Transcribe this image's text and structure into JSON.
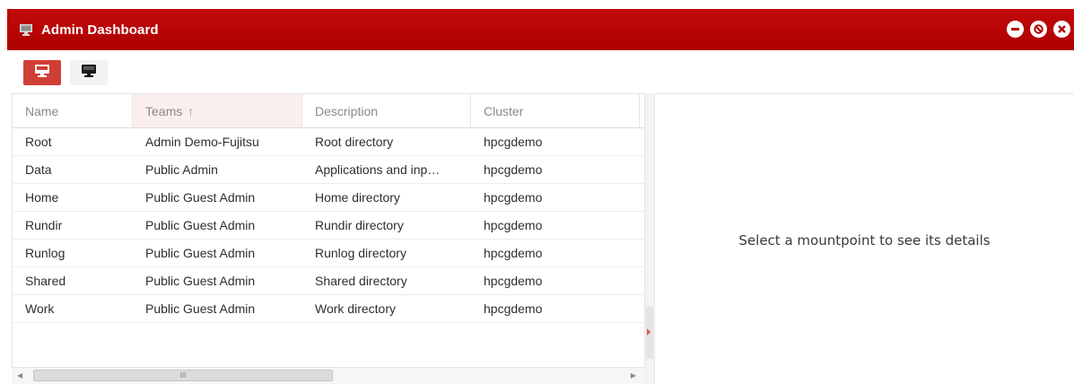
{
  "window": {
    "title": "Admin Dashboard",
    "accent_color": "#b30000",
    "controls": [
      "minimize-icon",
      "restore-icon",
      "close-icon"
    ]
  },
  "toolbar": {
    "buttons": [
      {
        "icon": "monitor-icon",
        "state": "active"
      },
      {
        "icon": "monitor-dark-icon",
        "state": "inactive"
      }
    ]
  },
  "grid": {
    "columns": [
      {
        "label": "Name"
      },
      {
        "label": "Teams",
        "sort": "↑"
      },
      {
        "label": "Description"
      },
      {
        "label": "Cluster"
      }
    ],
    "rows": [
      {
        "name": "Root",
        "teams": "Admin Demo-Fujitsu",
        "description": "Root directory",
        "cluster": "hpcgdemo"
      },
      {
        "name": "Data",
        "teams": "Public Admin",
        "description": "Applications and inp…",
        "cluster": "hpcgdemo"
      },
      {
        "name": "Home",
        "teams": "Public Guest Admin",
        "description": "Home directory",
        "cluster": "hpcgdemo"
      },
      {
        "name": "Rundir",
        "teams": "Public Guest Admin",
        "description": "Rundir directory",
        "cluster": "hpcgdemo"
      },
      {
        "name": "Runlog",
        "teams": "Public Guest Admin",
        "description": "Runlog directory",
        "cluster": "hpcgdemo"
      },
      {
        "name": "Shared",
        "teams": "Public Guest Admin",
        "description": "Shared directory",
        "cluster": "hpcgdemo"
      },
      {
        "name": "Work",
        "teams": "Public Guest Admin",
        "description": "Work directory",
        "cluster": "hpcgdemo"
      }
    ]
  },
  "scrollbar": {
    "thumb_grip": "III"
  },
  "detail": {
    "message": "Select a mountpoint to see its details"
  }
}
